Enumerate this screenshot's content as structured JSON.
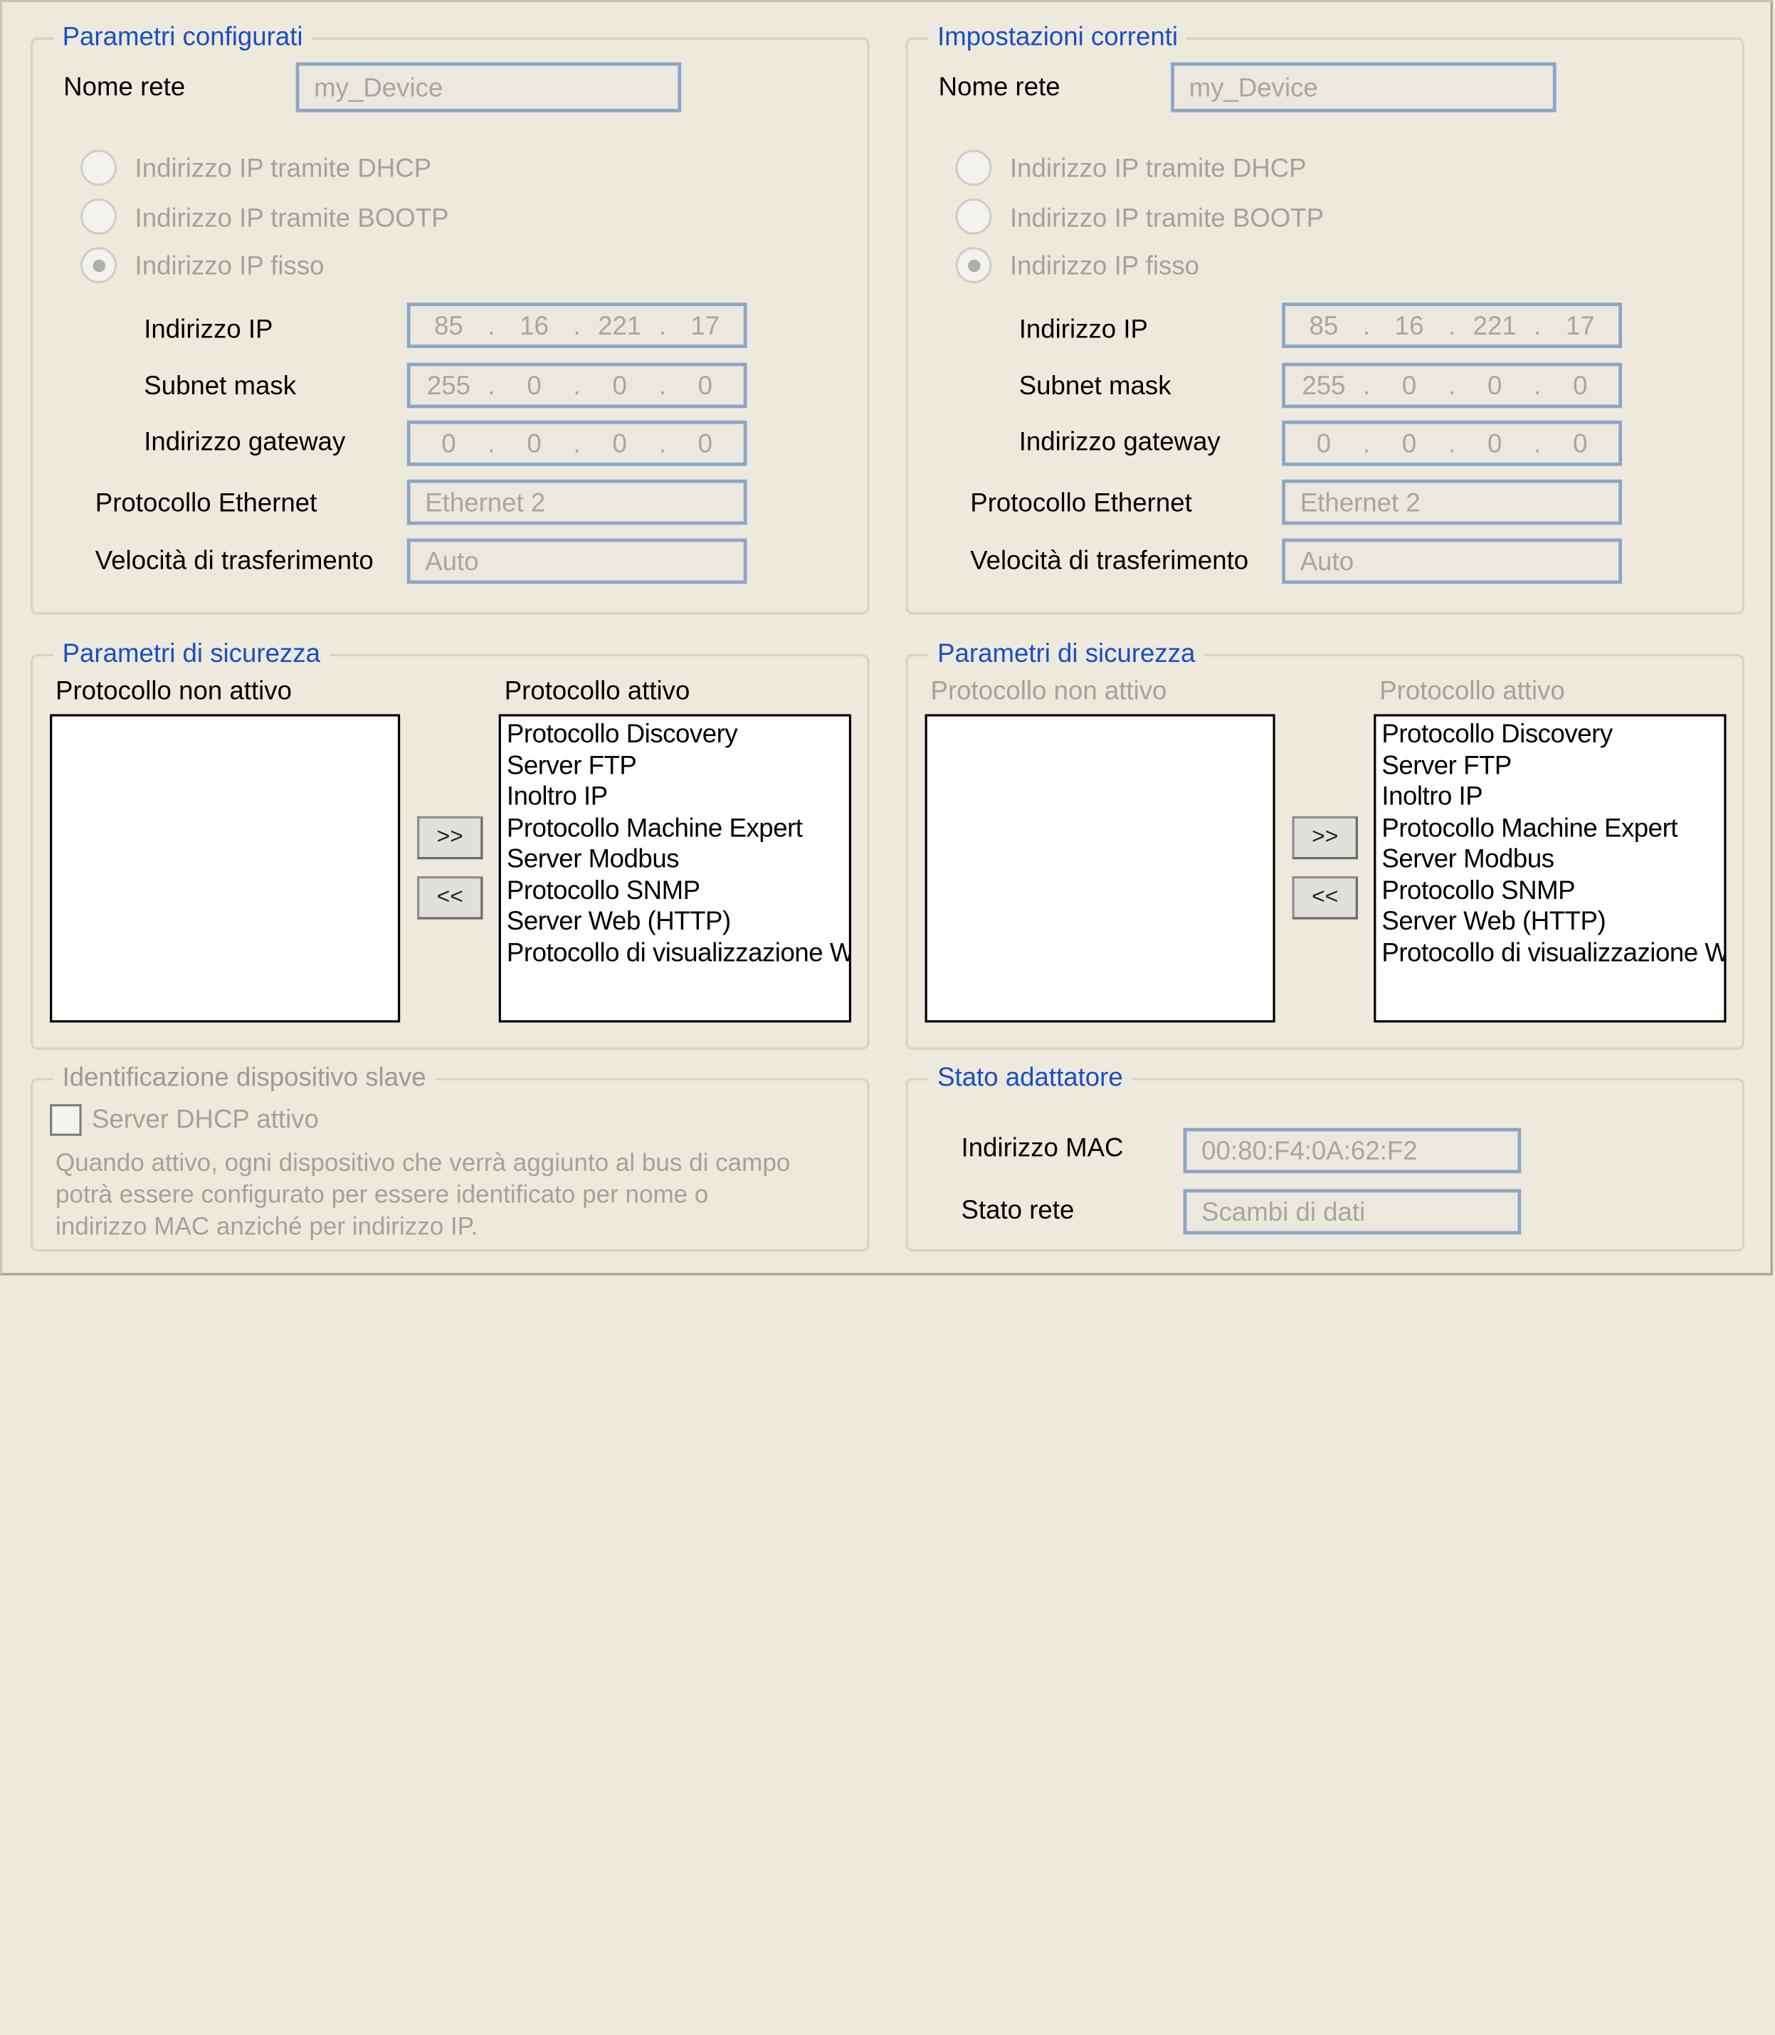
{
  "left": {
    "config": {
      "title": "Parametri configurati",
      "nome_rete_label": "Nome rete",
      "nome_rete_value": "my_Device",
      "radio_dhcp": "Indirizzo IP tramite DHCP",
      "radio_bootp": "Indirizzo IP tramite BOOTP",
      "radio_fisso": "Indirizzo IP fisso",
      "ip_label": "Indirizzo IP",
      "ip": [
        "85",
        "16",
        "221",
        "17"
      ],
      "subnet_label": "Subnet mask",
      "subnet": [
        "255",
        "0",
        "0",
        "0"
      ],
      "gateway_label": "Indirizzo gateway",
      "gateway": [
        "0",
        "0",
        "0",
        "0"
      ],
      "protocol_label": "Protocollo Ethernet",
      "protocol_value": "Ethernet 2",
      "speed_label": "Velocità di trasferimento",
      "speed_value": "Auto"
    },
    "security": {
      "title": "Parametri di sicurezza",
      "inactive_label": "Protocollo non attivo",
      "active_label": "Protocollo attivo",
      "add_button": ">>",
      "remove_button": "<<",
      "inactive_items": [],
      "active_items": [
        "Protocollo Discovery",
        "Server FTP",
        "Inoltro IP",
        "Protocollo Machine Expert",
        "Server Modbus",
        "Protocollo SNMP",
        "Server Web (HTTP)",
        "Protocollo di visualizzazione Web"
      ]
    },
    "slave": {
      "title": "Identificazione dispositivo slave",
      "checkbox_label": "Server DHCP attivo",
      "description": [
        "Quando attivo, ogni dispositivo che verrà aggiunto al bus di campo",
        "potrà essere configurato per essere identificato per nome o",
        "indirizzo MAC anziché per indirizzo IP."
      ]
    }
  },
  "right": {
    "current": {
      "title": "Impostazioni correnti",
      "nome_rete_label": "Nome rete",
      "nome_rete_value": "my_Device",
      "radio_dhcp": "Indirizzo IP tramite DHCP",
      "radio_bootp": "Indirizzo IP tramite BOOTP",
      "radio_fisso": "Indirizzo IP fisso",
      "ip_label": "Indirizzo IP",
      "ip": [
        "85",
        "16",
        "221",
        "17"
      ],
      "subnet_label": "Subnet mask",
      "subnet": [
        "255",
        "0",
        "0",
        "0"
      ],
      "gateway_label": "Indirizzo gateway",
      "gateway": [
        "0",
        "0",
        "0",
        "0"
      ],
      "protocol_label": "Protocollo Ethernet",
      "protocol_value": "Ethernet 2",
      "speed_label": "Velocità di trasferimento",
      "speed_value": "Auto"
    },
    "security": {
      "title": "Parametri di sicurezza",
      "inactive_label": "Protocollo non attivo",
      "active_label": "Protocollo attivo",
      "add_button": ">>",
      "remove_button": "<<",
      "inactive_items": [],
      "active_items": [
        "Protocollo Discovery",
        "Server FTP",
        "Inoltro IP",
        "Protocollo Machine Expert",
        "Server Modbus",
        "Protocollo SNMP",
        "Server Web (HTTP)",
        "Protocollo di visualizzazione Web"
      ]
    },
    "adapter": {
      "title": "Stato adattatore",
      "mac_label": "Indirizzo MAC",
      "mac_value": "00:80:F4:0A:62:F2",
      "state_label": "Stato rete",
      "state_value": "Scambi di dati"
    }
  }
}
